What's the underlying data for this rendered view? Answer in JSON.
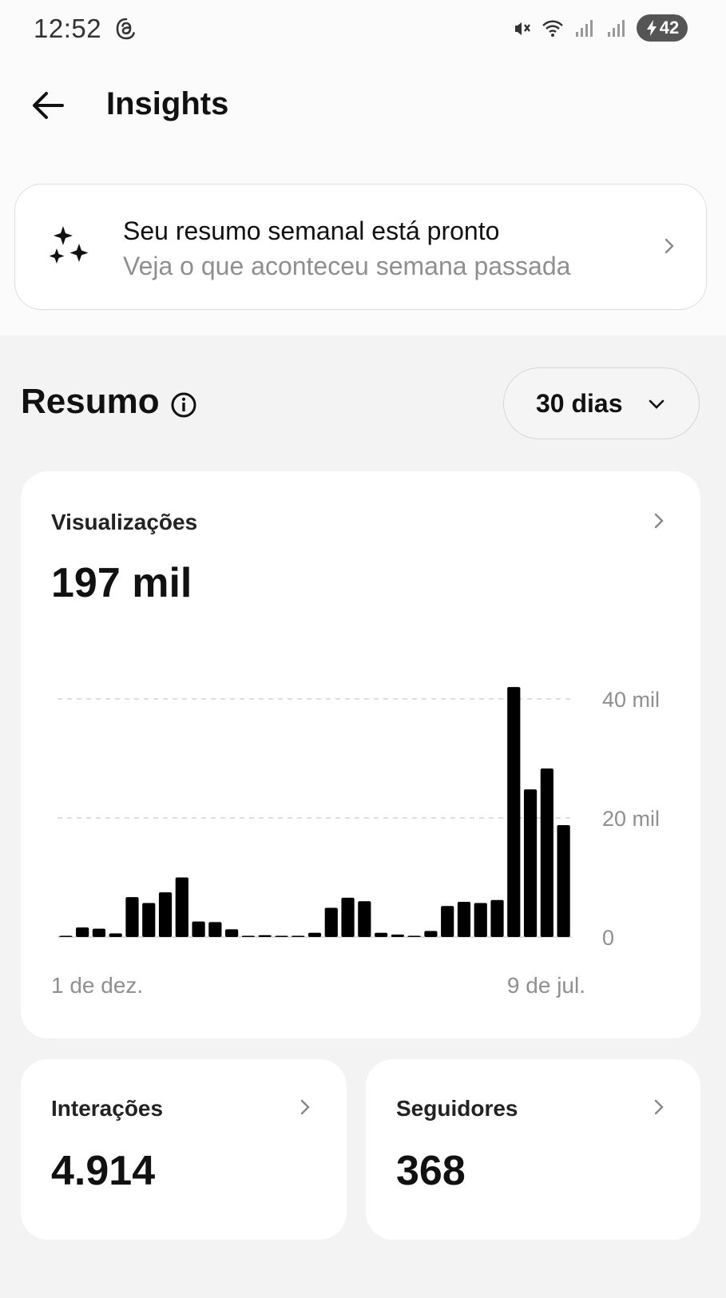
{
  "status_bar": {
    "time": "12:52",
    "battery": "42",
    "icons": [
      "threads-icon",
      "mute-icon",
      "wifi-icon",
      "signal-icon",
      "signal-icon",
      "battery-icon"
    ]
  },
  "header": {
    "title": "Insights",
    "back_icon": "arrow-left-icon"
  },
  "weekly_summary": {
    "title": "Seu resumo semanal está pronto",
    "subtitle": "Veja o que aconteceu semana passada",
    "icon": "sparkle-icon"
  },
  "summary": {
    "title": "Resumo",
    "info_icon": "info-icon",
    "range": "30 dias"
  },
  "views": {
    "label": "Visualizações",
    "value": "197 mil",
    "chart_data": {
      "type": "bar",
      "x_start_label": "1 de dez.",
      "x_end_label": "9 de jul.",
      "yticks": [
        "40 mil",
        "20 mil",
        "0"
      ],
      "ytick_values": [
        40000,
        20000,
        0
      ],
      "ylim": [
        0,
        40000
      ],
      "grid": true,
      "values": [
        0,
        1600,
        1400,
        600,
        6700,
        5700,
        7500,
        10000,
        2600,
        2500,
        1300,
        200,
        300,
        0,
        0,
        700,
        4900,
        6600,
        6000,
        700,
        400,
        200,
        1000,
        5200,
        5900,
        5700,
        6200,
        42000,
        24800,
        28300,
        18800
      ]
    }
  },
  "interactions": {
    "label": "Interações",
    "value": "4.914"
  },
  "followers": {
    "label": "Seguidores",
    "value": "368"
  },
  "colors": {
    "bar": "#000000",
    "background": "#f3f3f3",
    "card": "#ffffff",
    "muted_text": "#8f8f8f"
  }
}
